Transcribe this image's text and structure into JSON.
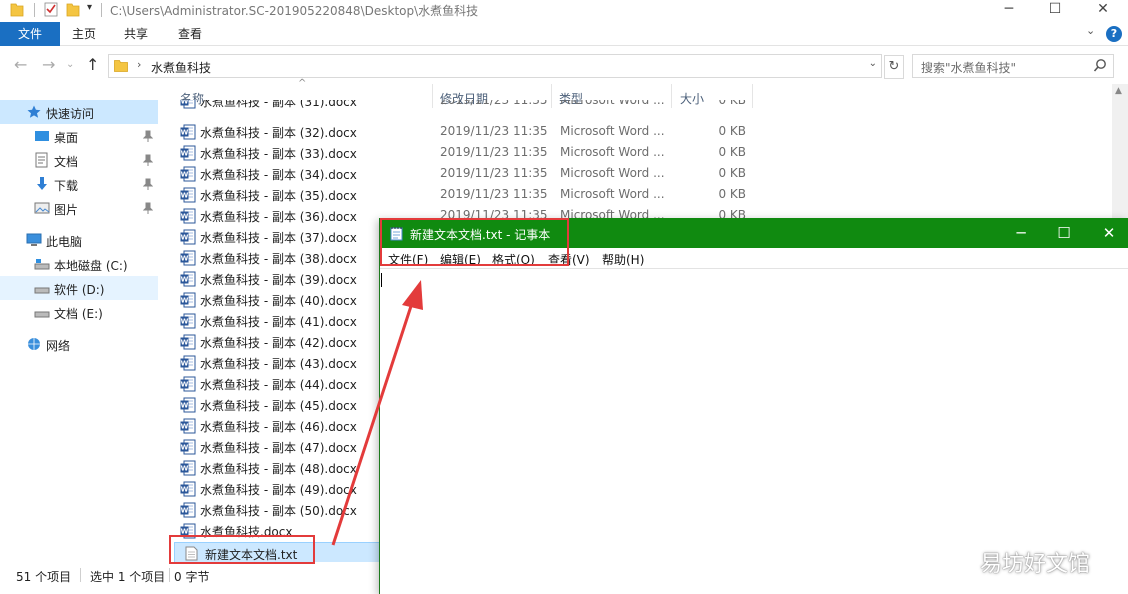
{
  "explorer": {
    "title_path": "C:\\Users\\Administrator.SC-201905220848\\Desktop\\水煮鱼科技",
    "ribbon_tabs": [
      "文件",
      "主页",
      "共享",
      "查看"
    ],
    "address": {
      "crumb": "水煮鱼科技"
    },
    "search": {
      "placeholder": "搜索\"水煮鱼科技\""
    },
    "nav": [
      {
        "label": "快速访问",
        "icon": "star-icon",
        "selected": true
      },
      {
        "label": "桌面",
        "icon": "desktop-icon",
        "pinned": true
      },
      {
        "label": "文档",
        "icon": "documents-icon",
        "pinned": true
      },
      {
        "label": "下载",
        "icon": "download-icon",
        "pinned": true
      },
      {
        "label": "图片",
        "icon": "pictures-icon",
        "pinned": true
      },
      {
        "label": "此电脑",
        "icon": "computer-icon"
      },
      {
        "label": "本地磁盘 (C:)",
        "icon": "system-drive-icon"
      },
      {
        "label": "软件 (D:)",
        "icon": "drive-icon",
        "hover": true
      },
      {
        "label": "文档 (E:)",
        "icon": "drive-icon"
      },
      {
        "label": "网络",
        "icon": "network-icon"
      }
    ],
    "columns": [
      "名称",
      "修改日期",
      "类型",
      "大小"
    ],
    "files": [
      {
        "name": "水煮鱼科技 - 副本 (31).docx",
        "date": "2019/11/23 11:35",
        "type": "Microsoft Word ...",
        "size": "0 KB"
      },
      {
        "name": "水煮鱼科技 - 副本 (32).docx",
        "date": "2019/11/23 11:35",
        "type": "Microsoft Word ...",
        "size": "0 KB"
      },
      {
        "name": "水煮鱼科技 - 副本 (33).docx",
        "date": "2019/11/23 11:35",
        "type": "Microsoft Word ...",
        "size": "0 KB"
      },
      {
        "name": "水煮鱼科技 - 副本 (34).docx",
        "date": "2019/11/23 11:35",
        "type": "Microsoft Word ...",
        "size": "0 KB"
      },
      {
        "name": "水煮鱼科技 - 副本 (35).docx",
        "date": "2019/11/23 11:35",
        "type": "Microsoft Word ...",
        "size": "0 KB"
      },
      {
        "name": "水煮鱼科技 - 副本 (36).docx",
        "date": "2019/11/23 11:35",
        "type": "Microsoft Word ...",
        "size": "0 KB"
      },
      {
        "name": "水煮鱼科技 - 副本 (37).docx",
        "date": "",
        "type": "",
        "size": ""
      },
      {
        "name": "水煮鱼科技 - 副本 (38).docx",
        "date": "",
        "type": "",
        "size": ""
      },
      {
        "name": "水煮鱼科技 - 副本 (39).docx",
        "date": "",
        "type": "",
        "size": ""
      },
      {
        "name": "水煮鱼科技 - 副本 (40).docx",
        "date": "",
        "type": "",
        "size": ""
      },
      {
        "name": "水煮鱼科技 - 副本 (41).docx",
        "date": "",
        "type": "",
        "size": ""
      },
      {
        "name": "水煮鱼科技 - 副本 (42).docx",
        "date": "",
        "type": "",
        "size": ""
      },
      {
        "name": "水煮鱼科技 - 副本 (43).docx",
        "date": "",
        "type": "",
        "size": ""
      },
      {
        "name": "水煮鱼科技 - 副本 (44).docx",
        "date": "",
        "type": "",
        "size": ""
      },
      {
        "name": "水煮鱼科技 - 副本 (45).docx",
        "date": "",
        "type": "",
        "size": ""
      },
      {
        "name": "水煮鱼科技 - 副本 (46).docx",
        "date": "",
        "type": "",
        "size": ""
      },
      {
        "name": "水煮鱼科技 - 副本 (47).docx",
        "date": "",
        "type": "",
        "size": ""
      },
      {
        "name": "水煮鱼科技 - 副本 (48).docx",
        "date": "",
        "type": "",
        "size": ""
      },
      {
        "name": "水煮鱼科技 - 副本 (49).docx",
        "date": "",
        "type": "",
        "size": ""
      },
      {
        "name": "水煮鱼科技 - 副本 (50).docx",
        "date": "",
        "type": "",
        "size": ""
      },
      {
        "name": "水煮鱼科技.docx",
        "date": "",
        "type": "",
        "size": ""
      },
      {
        "name": "新建文本文档.txt",
        "date": "",
        "type": "",
        "size": "",
        "selected": true,
        "kind": "txt"
      }
    ],
    "status": {
      "count": "51 个项目",
      "selected": "选中 1 个项目",
      "size": "0 字节"
    }
  },
  "notepad": {
    "title": "新建文本文档.txt - 记事本",
    "menu": [
      "文件(F)",
      "编辑(E)",
      "格式(O)",
      "查看(V)",
      "帮助(H)"
    ],
    "content": ""
  },
  "watermark": "易坊好文馆",
  "colors": {
    "accent": "#1a6fc2",
    "notepad_title": "#108a10",
    "annotation": "#e33b3b",
    "selection": "#cce8ff"
  }
}
